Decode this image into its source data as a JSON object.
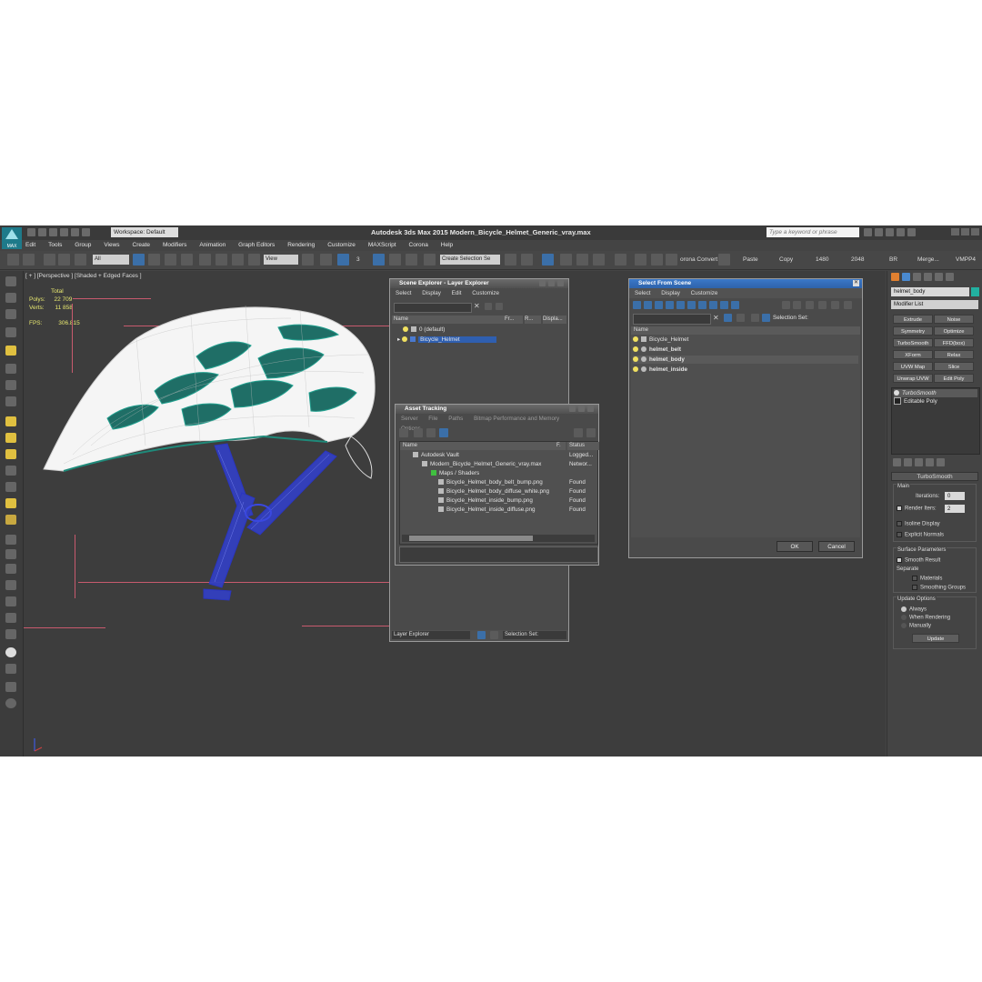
{
  "title_bar": {
    "app_title": "Autodesk 3ds Max  2015    Modern_Bicycle_Helmet_Generic_vray.max",
    "logo_text": "MAX",
    "workspace": "Workspace: Default",
    "search_placeholder": "Type a keyword or phrase"
  },
  "menu": [
    "Edit",
    "Tools",
    "Group",
    "Views",
    "Create",
    "Modifiers",
    "Animation",
    "Graph Editors",
    "Rendering",
    "Customize",
    "MAXScript",
    "Corona",
    "Help"
  ],
  "toolbar": {
    "filter_select": "All",
    "view_select": "View",
    "snap_value": "3",
    "selection_set": "Create Selection Se",
    "corona_label": "orona Convert",
    "paste_label": "Paste",
    "copy_label": "Copy",
    "res_w": "1480",
    "res_h": "2048",
    "br_label": "BR",
    "merge_label": "Merge...",
    "vmpp_label": "VMPP4"
  },
  "viewport": {
    "label": "[ + ] [Perspective ] [Shaded + Edged Faces ]",
    "stats": {
      "total_label": "Total",
      "polys_label": "Polys:",
      "polys_value": "22 709",
      "verts_label": "Verts:",
      "verts_value": "11 858",
      "fps_label": "FPS:",
      "fps_value": "306.815"
    }
  },
  "scene_explorer": {
    "title": "Scene Explorer - Layer Explorer",
    "menu": [
      "Select",
      "Display",
      "Edit",
      "Customize"
    ],
    "columns": {
      "name": "Name",
      "fr": "Fr...",
      "r": "R...",
      "disp": "Displa..."
    },
    "rows": [
      "0 (default)",
      "Bicycle_Helmet"
    ],
    "footer_left": "Layer Explorer",
    "footer_right": "Selection Set:"
  },
  "asset_tracking": {
    "title": "Asset Tracking",
    "menu": [
      "Server",
      "File",
      "Paths",
      "Bitmap Performance and Memory",
      "Options"
    ],
    "columns": {
      "name": "Name",
      "f": "F.",
      "status": "Status"
    },
    "rows": [
      {
        "name": "Autodesk Vault",
        "status": "Logged..."
      },
      {
        "name": "Modern_Bicycle_Helmet_Generic_vray.max",
        "status": "Networ..."
      },
      {
        "name": "Maps / Shaders",
        "status": ""
      },
      {
        "name": "Bicycle_Helmet_body_belt_bump.png",
        "status": "Found"
      },
      {
        "name": "Bicycle_Helmet_body_diffuse_white.png",
        "status": "Found"
      },
      {
        "name": "Bicycle_Helmet_inside_bump.png",
        "status": "Found"
      },
      {
        "name": "Bicycle_Helmet_inside_diffuse.png",
        "status": "Found"
      }
    ]
  },
  "select_from_scene": {
    "title": "Select From Scene",
    "menu": [
      "Select",
      "Display",
      "Customize"
    ],
    "selection_set_label": "Selection Set:",
    "column_name": "Name",
    "rows": [
      "Bicycle_Helmet",
      "helmet_belt",
      "helmet_body",
      "helmet_inside"
    ],
    "ok": "OK",
    "cancel": "Cancel"
  },
  "command_panel": {
    "object_name": "helmet_body",
    "modifier_list": "Modifier List",
    "buttons": [
      "Extrude",
      "Noise",
      "Symmetry",
      "Optimize",
      "TurboSmooth",
      "FFD(box)",
      "XForm",
      "Relax",
      "UVW Map",
      "Slice",
      "Unwrap UVW",
      "Edit Poly"
    ],
    "stack": [
      "TurboSmooth",
      "Editable Poly"
    ],
    "rollout_title": "TurboSmooth",
    "main_label": "Main",
    "iterations_label": "Iterations:",
    "iterations_value": "0",
    "render_iters_label": "Render Iters:",
    "render_iters_value": "2",
    "isoline_label": "Isoline Display",
    "explicit_label": "Explicit Normals",
    "surface_params": "Surface Parameters",
    "smooth_result": "Smooth Result",
    "separate": "Separate",
    "materials": "Materials",
    "smoothing_groups": "Smoothing Groups",
    "update_options": "Update Options",
    "always": "Always",
    "when_rendering": "When Rendering",
    "manually": "Manually",
    "update": "Update"
  },
  "colors": {
    "accent": "#2f5fb0",
    "bg": "#444444",
    "grid": "#c85a6e",
    "wire_blue": "#2a35c8",
    "teal": "#1f8a7a"
  }
}
